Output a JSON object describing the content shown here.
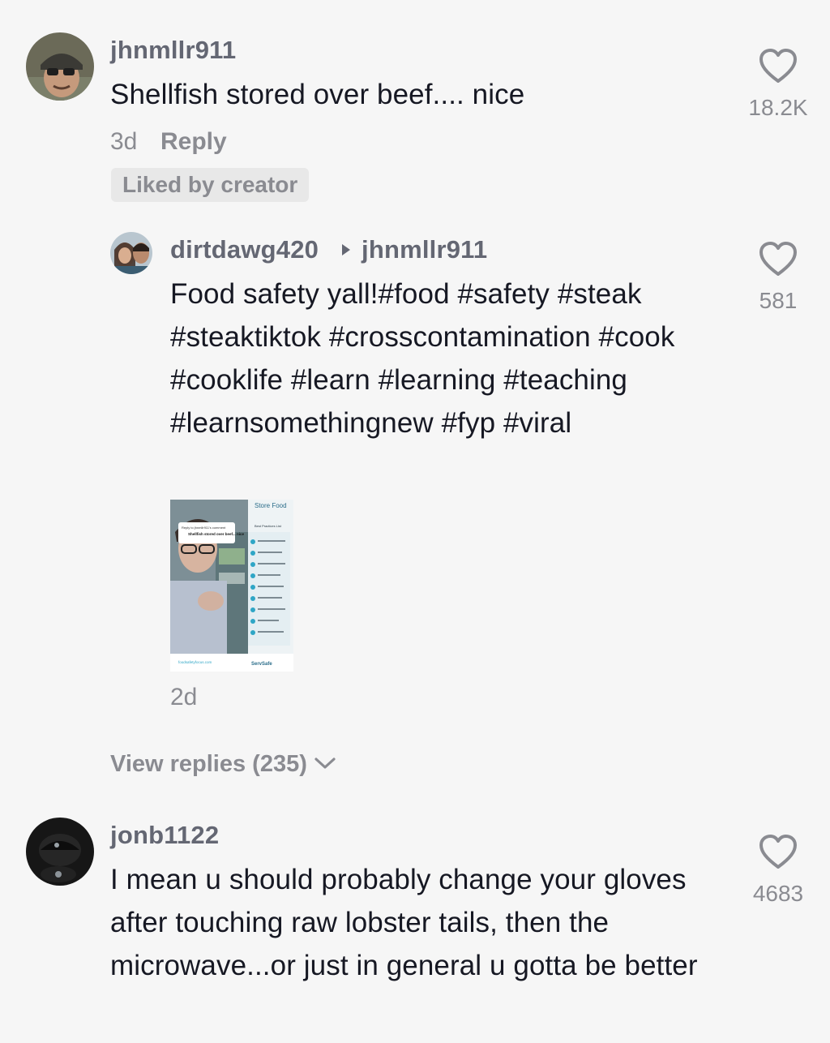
{
  "comments": [
    {
      "username": "jhnmllr911",
      "text": "Shellfish stored over beef.... nice",
      "age": "3d",
      "reply_label": "Reply",
      "badge": "Liked by creator",
      "likes": "18.2K"
    },
    {
      "username": "jonb1122",
      "text": "I mean u should probably change your gloves after touching raw lobster tails, then the microwave...or just in general u gotta be better",
      "likes": "4683"
    }
  ],
  "reply": {
    "username": "dirtdawg420",
    "reply_to": "jhnmllr911",
    "text": "Food safety yall!#food #safety #steak #steaktiktok #crosscontamination #cook #cooklife #learn #learning #teaching #learnsomethingnew #fyp #viral",
    "likes": "581",
    "age": "2d",
    "thumbnail": {
      "title": "Store Food",
      "subtitle": "Best Practices List",
      "overlay_heading": "Reply to jhnmllr911's comment",
      "overlay_text": "Shellfish stored over beef... nice",
      "footer_link": "foodsafetyfocus.com",
      "brand": "ServSafe"
    }
  },
  "view_replies_label": "View replies (235)",
  "icons": {
    "heart": "heart-outline-icon",
    "chevron": "chevron-down-icon",
    "arrow": "caret-right-icon"
  },
  "colors": {
    "background": "#f6f6f6",
    "text": "#161823",
    "muted": "#8a8b91",
    "username": "#646773",
    "badge_bg": "#e8e8e8"
  }
}
